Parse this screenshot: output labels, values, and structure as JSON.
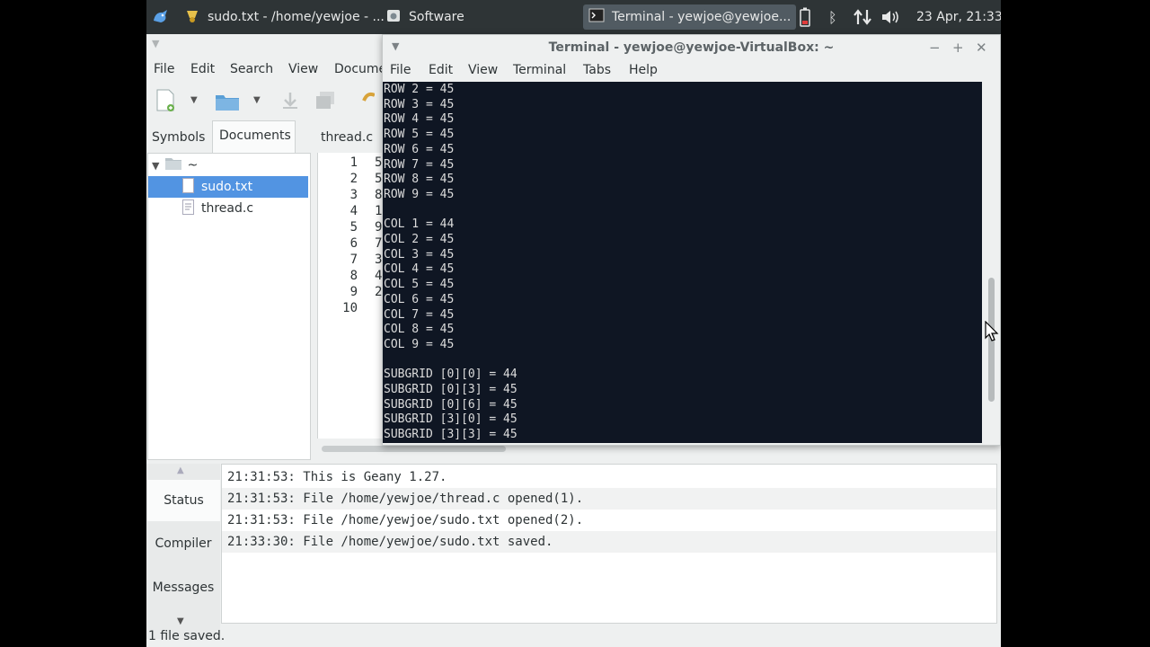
{
  "panel": {
    "tasks": [
      {
        "label": "sudo.txt - /home/yewjoe - ...",
        "icon": "geany-icon"
      },
      {
        "label": "Software",
        "icon": "software-icon"
      },
      {
        "label": "Terminal - yewjoe@yewjoe...",
        "icon": "terminal-icon"
      }
    ],
    "clock": "23 Apr, 21:33"
  },
  "geany": {
    "menu": [
      "File",
      "Edit",
      "Search",
      "View",
      "Docume"
    ],
    "sidebar_tabs": [
      "Symbols",
      "Documents"
    ],
    "doc_tab": "thread.c",
    "tree": {
      "root": "~",
      "files": [
        "sudo.txt",
        "thread.c"
      ]
    },
    "line_numbers": [
      "1",
      "2",
      "3",
      "4",
      "5",
      "6",
      "7",
      "8",
      "9",
      "10"
    ],
    "code_chars": [
      "5",
      "5",
      "8",
      "1",
      "9",
      "7",
      "3",
      "4",
      "2",
      ""
    ],
    "msg_tabs": [
      "Status",
      "Compiler",
      "Messages"
    ],
    "status_log": [
      "21:31:53: This is Geany 1.27.",
      "21:31:53: File /home/yewjoe/thread.c opened(1).",
      "21:31:53: File /home/yewjoe/sudo.txt opened(2).",
      "21:33:30: File /home/yewjoe/sudo.txt saved."
    ],
    "statusbar": "1 file saved."
  },
  "terminal": {
    "title": "Terminal - yewjoe@yewjoe-VirtualBox: ~",
    "menu": [
      "File",
      "Edit",
      "View",
      "Terminal",
      "Tabs",
      "Help"
    ],
    "lines": [
      "ROW 2 = 45",
      "ROW 3 = 45",
      "ROW 4 = 45",
      "ROW 5 = 45",
      "ROW 6 = 45",
      "ROW 7 = 45",
      "ROW 8 = 45",
      "ROW 9 = 45",
      "",
      "COL 1 = 44",
      "COL 2 = 45",
      "COL 3 = 45",
      "COL 4 = 45",
      "COL 5 = 45",
      "COL 6 = 45",
      "COL 7 = 45",
      "COL 8 = 45",
      "COL 9 = 45",
      "",
      "SUBGRID [0][0] = 44",
      "SUBGRID [0][3] = 45",
      "SUBGRID [0][6] = 45",
      "SUBGRID [3][0] = 45",
      "SUBGRID [3][3] = 45"
    ]
  }
}
